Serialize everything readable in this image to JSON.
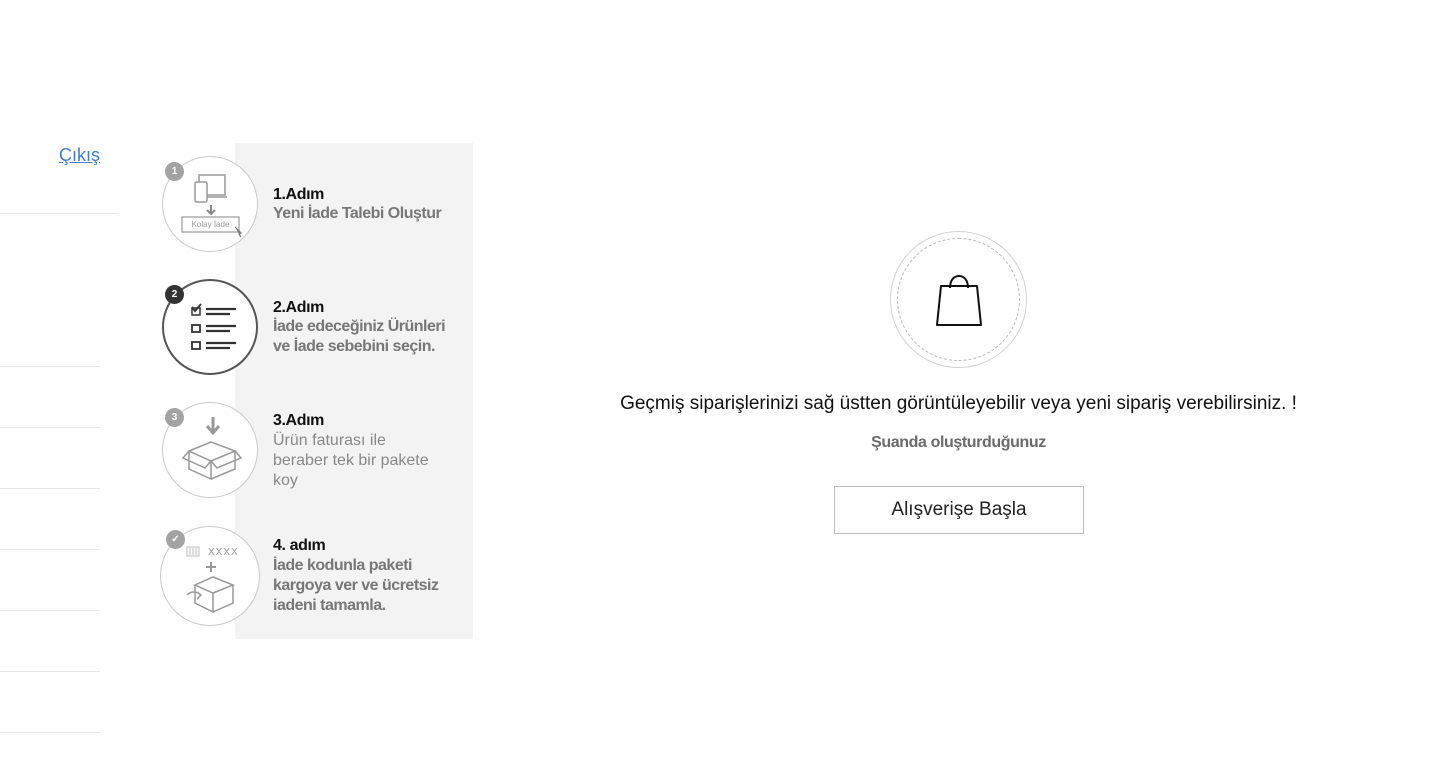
{
  "sidebar": {
    "logout_label": "Çıkış"
  },
  "steps": [
    {
      "badge": "1",
      "title": "1.Adım",
      "lines": [
        "Yeni İade Talebi Oluştur"
      ],
      "icon_label": "Kolay İade"
    },
    {
      "badge": "2",
      "title": "2.Adım",
      "lines": [
        "İade edeceğiniz Ürünleri",
        "ve İade sebebini seçin."
      ]
    },
    {
      "badge": "3",
      "title": "3.Adım",
      "lines": [
        "Ürün faturası ile",
        "beraber tek bir pakete",
        "koy"
      ]
    },
    {
      "badge": "✓",
      "title": "4. adım",
      "lines": [
        "İade kodunla paketi",
        "kargoya ver ve ücretsiz",
        "iadeni tamamla."
      ],
      "icon_label": "XXXX"
    }
  ],
  "empty_state": {
    "message": "Geçmiş siparişlerinizi sağ üstten görüntüleyebilir veya yeni sipariş verebilirsiniz. !",
    "sub_message": "Şuanda oluşturduğunuz",
    "button_label": "Alışverişe Başla"
  }
}
